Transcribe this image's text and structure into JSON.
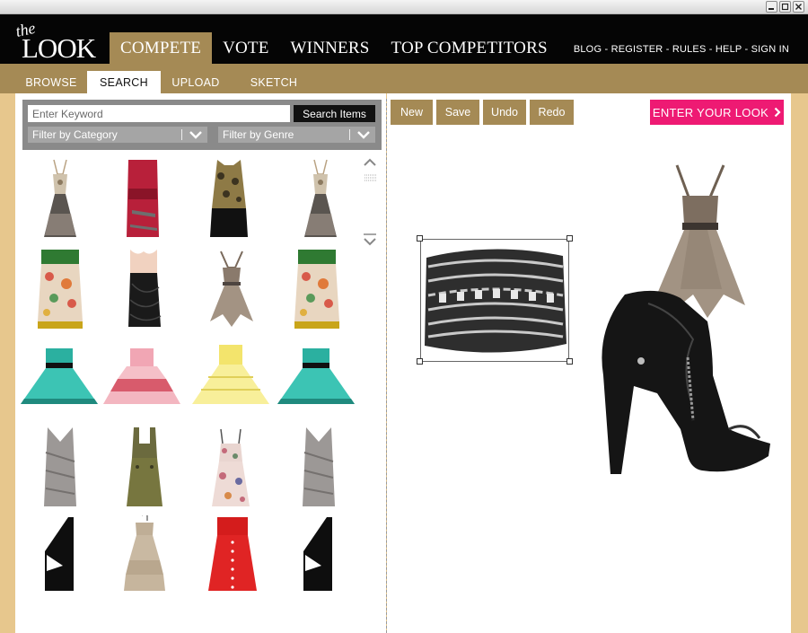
{
  "window": {
    "buttons": [
      {
        "name": "minimize-icon"
      },
      {
        "name": "maximize-icon"
      },
      {
        "name": "close-icon"
      }
    ]
  },
  "brand": {
    "logo_small": "the",
    "logo_big": "LOOK"
  },
  "nav": {
    "main": [
      "COMPETE",
      "VOTE",
      "WINNERS",
      "TOP COMPETITORS"
    ],
    "active": "COMPETE",
    "utility": [
      "BLOG",
      "REGISTER",
      "RULES",
      "HELP",
      "SIGN IN"
    ],
    "utility_separator": " - "
  },
  "subnav": {
    "tabs": [
      "BROWSE",
      "SEARCH",
      "UPLOAD",
      "SKETCH"
    ],
    "active": "SEARCH"
  },
  "search": {
    "placeholder": "Enter Keyword",
    "button_label": "Search Items",
    "filter_category": "Filter by Category",
    "filter_genre": "Filter by Genre"
  },
  "toolbar": {
    "buttons": [
      "New",
      "Save",
      "Undo",
      "Redo"
    ],
    "enter_label": "ENTER YOUR LOOK",
    "enter_icon": "chevron-right-icon"
  },
  "colors": {
    "accent_gold": "#a58a55",
    "page_tan": "#e7c78d",
    "header_black": "#050505",
    "cta_pink": "#ee1a73"
  },
  "catalog": [
    [
      {
        "name": "lace-halter-dress",
        "icon": "dress-icon"
      },
      {
        "name": "red-strapless-dress",
        "icon": "dress-icon"
      },
      {
        "name": "gold-embellished-dress",
        "icon": "dress-icon"
      },
      {
        "name": "lace-halter-dress",
        "icon": "dress-icon"
      }
    ],
    [
      {
        "name": "floral-strapless-dress",
        "icon": "dress-icon"
      },
      {
        "name": "black-draped-dress",
        "icon": "dress-icon"
      },
      {
        "name": "ruffled-taupe-dress",
        "icon": "dress-icon"
      },
      {
        "name": "floral-strapless-dress",
        "icon": "dress-icon"
      }
    ],
    [
      {
        "name": "teal-tulle-dress",
        "icon": "dress-icon"
      },
      {
        "name": "pink-ruffle-dress",
        "icon": "dress-icon"
      },
      {
        "name": "yellow-tulle-dress",
        "icon": "dress-icon"
      },
      {
        "name": "teal-tulle-dress",
        "icon": "dress-icon"
      }
    ],
    [
      {
        "name": "grey-bandage-dress",
        "icon": "dress-icon"
      },
      {
        "name": "olive-pinafore-dress",
        "icon": "dress-icon"
      },
      {
        "name": "floral-sundress",
        "icon": "dress-icon"
      },
      {
        "name": "grey-bandage-dress",
        "icon": "dress-icon"
      }
    ],
    [
      {
        "name": "black-cutout-dress",
        "icon": "dress-icon"
      },
      {
        "name": "beige-tiered-dress",
        "icon": "dress-icon"
      },
      {
        "name": "red-button-dress",
        "icon": "dress-icon"
      },
      {
        "name": "black-cutout-dress",
        "icon": "dress-icon"
      }
    ]
  ],
  "canvas_items": [
    {
      "name": "chain-cuff-bracelet",
      "icon": "bracelet-icon",
      "selected": true
    },
    {
      "name": "ruffled-taupe-dress",
      "icon": "dress-icon",
      "selected": false
    },
    {
      "name": "black-leather-bootie",
      "icon": "boot-icon",
      "selected": false
    }
  ]
}
